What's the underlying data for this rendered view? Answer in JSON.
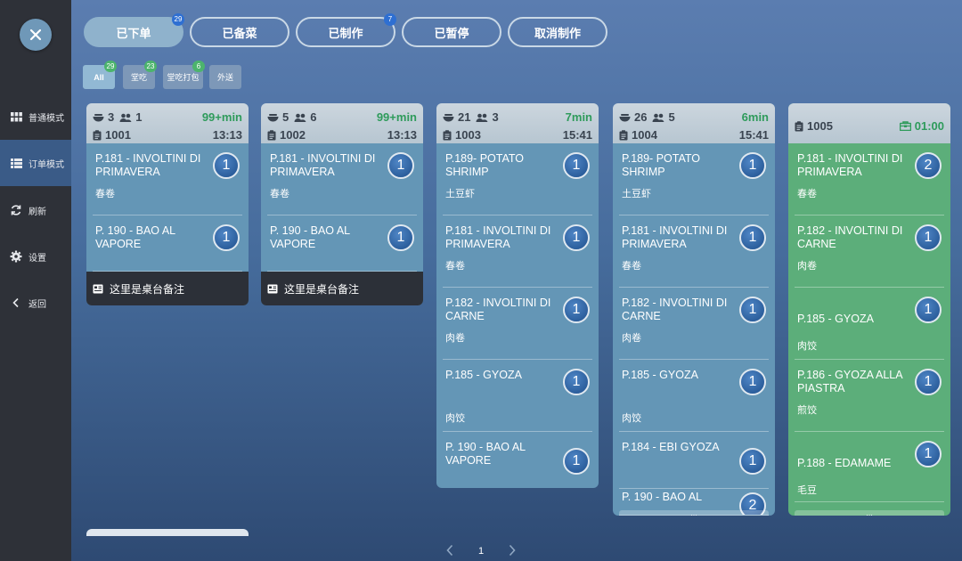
{
  "sidebar": {
    "items": [
      {
        "label": "普通模式",
        "icon": "grid-icon"
      },
      {
        "label": "订单模式",
        "icon": "list-icon",
        "active": true
      },
      {
        "label": "刷新",
        "icon": "refresh-icon"
      },
      {
        "label": "设置",
        "icon": "gear-icon"
      },
      {
        "label": "返回",
        "icon": "chevron-left-icon"
      }
    ]
  },
  "tabs": [
    {
      "label": "已下单",
      "badge": "29",
      "active": true
    },
    {
      "label": "已备菜",
      "badge": ""
    },
    {
      "label": "已制作",
      "badge": "7"
    },
    {
      "label": "已暂停",
      "badge": ""
    },
    {
      "label": "取消制作",
      "badge": ""
    }
  ],
  "filters": [
    {
      "label": "All",
      "badge": "29",
      "active": true
    },
    {
      "label": "堂吃",
      "badge": "23"
    },
    {
      "label": "堂吃打包",
      "badge": "6"
    },
    {
      "label": "外送",
      "badge": ""
    }
  ],
  "orders": [
    {
      "guests": "3",
      "people": "1",
      "elapsed": "99+min",
      "number": "1001",
      "time": "13:13",
      "items": [
        {
          "name": "P.181 - INVOLTINI DI PRIMAVERA",
          "cn": "春卷",
          "qty": "1"
        },
        {
          "name": "P. 190 - BAO AL VAPORE",
          "cn": "",
          "qty": "1"
        }
      ],
      "note": "这里是桌台备注"
    },
    {
      "guests": "5",
      "people": "6",
      "elapsed": "99+min",
      "number": "1002",
      "time": "13:13",
      "items": [
        {
          "name": "P.181 - INVOLTINI DI PRIMAVERA",
          "cn": "春卷",
          "qty": "1"
        },
        {
          "name": "P. 190 - BAO AL VAPORE",
          "cn": "",
          "qty": "1"
        }
      ],
      "note": "这里是桌台备注"
    },
    {
      "guests": "21",
      "people": "3",
      "elapsed": "7min",
      "number": "1003",
      "time": "15:41",
      "items": [
        {
          "name": "P.189- POTATO SHRIMP",
          "cn": "土豆虾",
          "qty": "1"
        },
        {
          "name": "P.181 - INVOLTINI DI PRIMAVERA",
          "cn": "春卷",
          "qty": "1"
        },
        {
          "name": "P.182 - INVOLTINI DI CARNE",
          "cn": "肉卷",
          "qty": "1"
        },
        {
          "name": "P.185 - GYOZA",
          "cn": "肉饺",
          "qty": "1"
        },
        {
          "name": "P. 190 - BAO AL VAPORE",
          "cn": "",
          "qty": "1"
        }
      ]
    },
    {
      "guests": "26",
      "people": "5",
      "elapsed": "6min",
      "number": "1004",
      "time": "15:41",
      "items": [
        {
          "name": "P.189- POTATO SHRIMP",
          "cn": "土豆虾",
          "qty": "1"
        },
        {
          "name": "P.181 - INVOLTINI DI PRIMAVERA",
          "cn": "春卷",
          "qty": "1"
        },
        {
          "name": "P.182 - INVOLTINI DI CARNE",
          "cn": "肉卷",
          "qty": "1"
        },
        {
          "name": "P.185 - GYOZA",
          "cn": "肉饺",
          "qty": "1"
        },
        {
          "name": "P.184 - EBI GYOZA",
          "cn": "",
          "qty": "1"
        },
        {
          "name": "P. 190 - BAO AL",
          "cn": "",
          "qty": "2"
        }
      ]
    },
    {
      "number": "1005",
      "timer": "01:00",
      "items": [
        {
          "name": "P.181 - INVOLTINI DI PRIMAVERA",
          "cn": "春卷",
          "qty": "2"
        },
        {
          "name": "P.182 - INVOLTINI DI CARNE",
          "cn": "肉卷",
          "qty": "1"
        },
        {
          "name": "P.185 - GYOZA",
          "cn": "肉饺",
          "qty": "1"
        },
        {
          "name": "P.186 - GYOZA ALLA PIASTRA",
          "cn": "煎饺",
          "qty": "1"
        },
        {
          "name": "P.188 - EDAMAME",
          "cn": "毛豆",
          "qty": "1"
        }
      ]
    }
  ],
  "more_indicator": "...",
  "pager": {
    "page": "1"
  },
  "colors": {
    "accent_green": "#2e9b5b",
    "card_blue": "#6496b6",
    "card_green": "#5cae7a",
    "qty_blue": "#2e64a8"
  }
}
